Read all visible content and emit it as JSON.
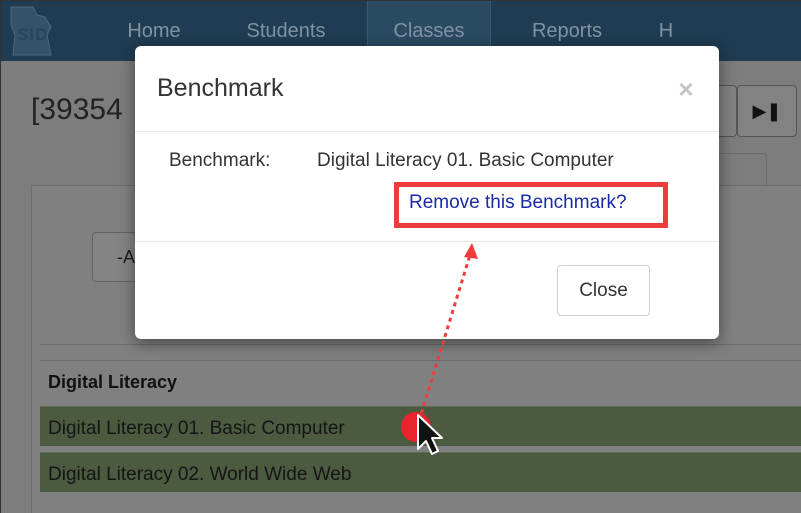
{
  "logo": {
    "text": "SID"
  },
  "navbar": {
    "items": [
      {
        "label": "Home"
      },
      {
        "label": "Students"
      },
      {
        "label": "Classes"
      },
      {
        "label": "Reports"
      },
      {
        "label": "H"
      }
    ]
  },
  "page": {
    "title": "[39354",
    "filter_select_text": "-A",
    "section_header": "Digital Literacy",
    "rows": [
      {
        "label": "Digital Literacy 01. Basic Computer"
      },
      {
        "label": "Digital Literacy 02. World Wide Web"
      }
    ]
  },
  "modal": {
    "title": "Benchmark",
    "close_x": "×",
    "field_label": "Benchmark:",
    "field_value": "Digital Literacy 01. Basic Computer",
    "remove_link": "Remove this Benchmark?",
    "close_button": "Close"
  },
  "colors": {
    "navbar": "#1f3c52",
    "highlight": "#ee3b3b",
    "link": "#1a2aa8",
    "row_green": "#4c5a3f"
  },
  "icons": {
    "last_page": "skip-to-end-icon",
    "cursor": "mouse-pointer-icon"
  }
}
